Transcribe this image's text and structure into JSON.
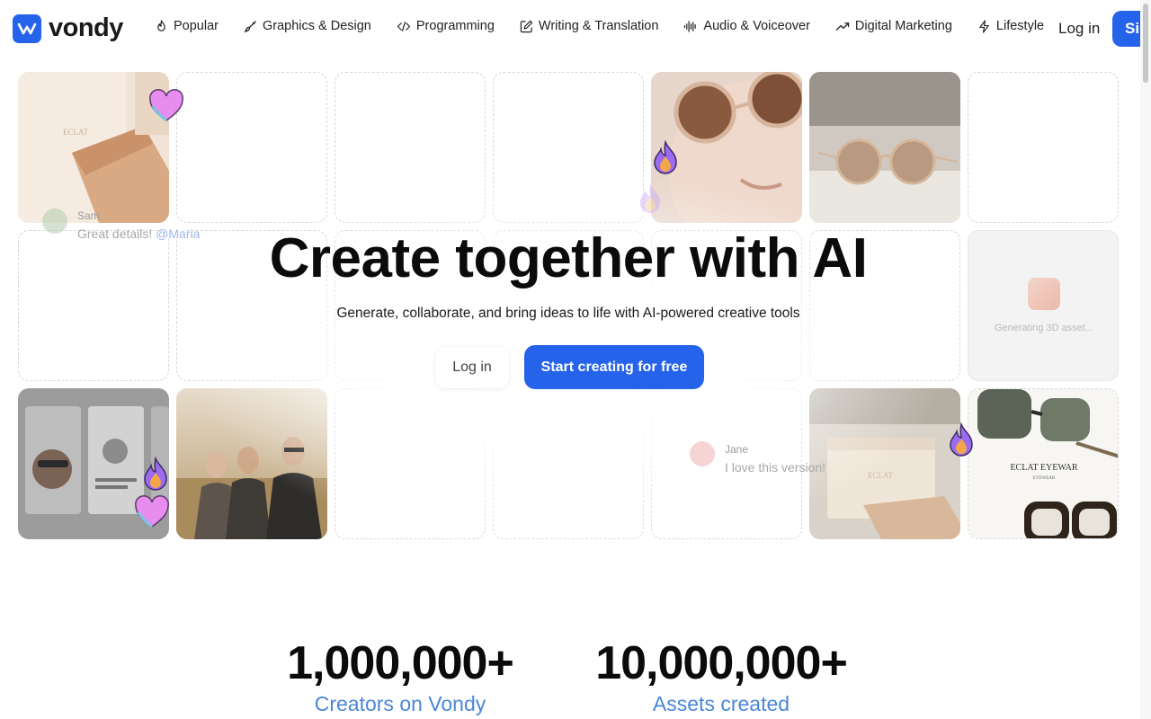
{
  "brand": {
    "name": "vondy",
    "accent": "#2563eb"
  },
  "nav": {
    "items": [
      {
        "label": "Popular",
        "icon": "fire-icon"
      },
      {
        "label": "Graphics & Design",
        "icon": "brush-icon"
      },
      {
        "label": "Programming",
        "icon": "code-icon"
      },
      {
        "label": "Writing & Translation",
        "icon": "pencil-square-icon"
      },
      {
        "label": "Audio & Voiceover",
        "icon": "waveform-icon"
      },
      {
        "label": "Digital Marketing",
        "icon": "trending-up-icon"
      },
      {
        "label": "Lifestyle",
        "icon": "lightning-icon"
      }
    ],
    "login": "Log in",
    "signup": "Si"
  },
  "hero": {
    "title": "Create together with AI",
    "subtitle": "Generate, collaborate, and bring ideas to life with AI-powered creative tools",
    "login_button": "Log in",
    "start_button": "Start creating for free"
  },
  "comments": [
    {
      "name": "Sam",
      "text": "Great details! ",
      "mention": "@Maria"
    },
    {
      "name": "Jane",
      "text": "I love this version!"
    }
  ],
  "generating": {
    "text": "Generating 3D asset..."
  },
  "gallery": {
    "brand_label": "ECLAT EYEWAR",
    "brand_sublabel": "EYEWEAR",
    "case_label": "ECLAT"
  },
  "stats": [
    {
      "value": "1,000,000+",
      "label": "Creators on Vondy"
    },
    {
      "value": "10,000,000+",
      "label": "Assets created"
    }
  ]
}
